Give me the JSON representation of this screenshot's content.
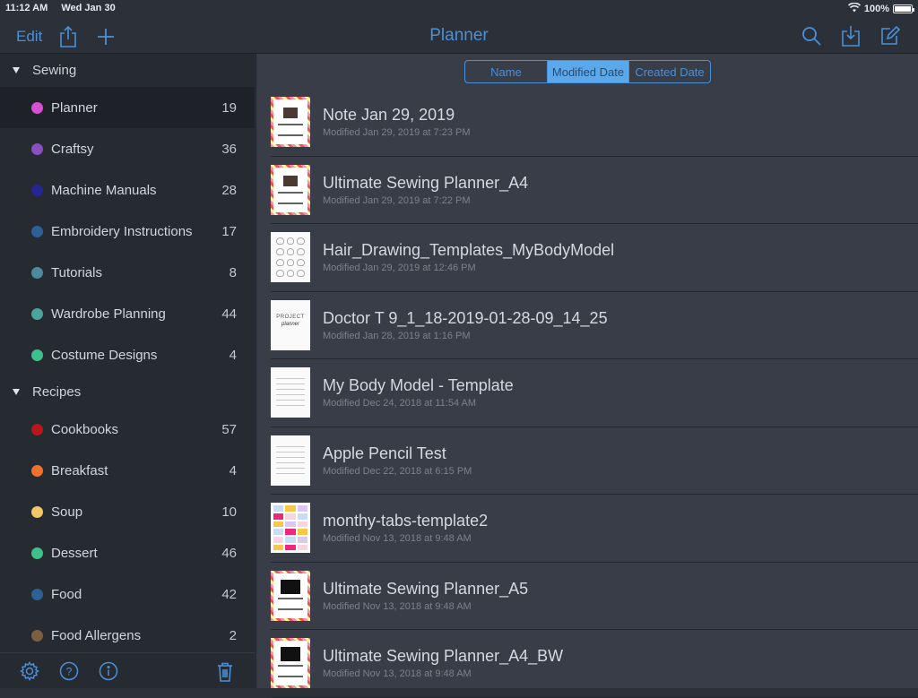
{
  "status_bar": {
    "time": "11:12 AM",
    "date": "Wed Jan 30",
    "battery": "100%",
    "battery_level": 1.0
  },
  "nav": {
    "edit_label": "Edit",
    "title": "Planner",
    "left_icons": [
      "share-icon",
      "plus-icon"
    ],
    "right_icons": [
      "search-icon",
      "import-icon",
      "compose-icon"
    ]
  },
  "colors": {
    "accent": "#4a90d9",
    "segment_active": "#5aa9ec",
    "sidebar_bg": "#262a31",
    "main_bg": "#383d47"
  },
  "sidebar": {
    "groups": [
      {
        "label": "Sewing",
        "items": [
          {
            "label": "Planner",
            "count": "19",
            "color": "#d94fd1",
            "selected": true
          },
          {
            "label": "Craftsy",
            "count": "36",
            "color": "#8a4fc1"
          },
          {
            "label": "Machine Manuals",
            "count": "28",
            "color": "#25259a"
          },
          {
            "label": "Embroidery Instructions",
            "count": "17",
            "color": "#2d6196"
          },
          {
            "label": "Tutorials",
            "count": "8",
            "color": "#4d8a9e"
          },
          {
            "label": "Wardrobe Planning",
            "count": "44",
            "color": "#4ba59a"
          },
          {
            "label": "Costume Designs",
            "count": "4",
            "color": "#3ec08a"
          }
        ]
      },
      {
        "label": "Recipes",
        "items": [
          {
            "label": "Cookbooks",
            "count": "57",
            "color": "#b8171b"
          },
          {
            "label": "Breakfast",
            "count": "4",
            "color": "#f0722a"
          },
          {
            "label": "Soup",
            "count": "10",
            "color": "#f2c766"
          },
          {
            "label": "Dessert",
            "count": "46",
            "color": "#3ec08a"
          },
          {
            "label": "Food",
            "count": "42",
            "color": "#2d6196"
          },
          {
            "label": "Food Allergens",
            "count": "2",
            "color": "#7a6040"
          }
        ]
      }
    ],
    "footer_icons": [
      "gear-icon",
      "help-icon",
      "info-icon",
      "trash-icon"
    ]
  },
  "sort": {
    "options": [
      "Name",
      "Modified Date",
      "Created Date"
    ],
    "selected": "Modified Date"
  },
  "documents": [
    {
      "name": "Note Jan 29, 2019",
      "meta": "Modified Jan 29, 2019 at 7:23 PM",
      "thumb": "sewing"
    },
    {
      "name": "Ultimate Sewing Planner_A4",
      "meta": "Modified Jan 29, 2019 at 7:22 PM",
      "thumb": "sewing"
    },
    {
      "name": "Hair_Drawing_Templates_MyBodyModel",
      "meta": "Modified Jan 29, 2019 at 12:46 PM",
      "thumb": "hair"
    },
    {
      "name": "Doctor T 9_1_18-2019-01-28-09_14_25",
      "meta": "Modified Jan 28, 2019 at 1:16 PM",
      "thumb": "project",
      "thumb_text": [
        "PROJECT",
        "planner"
      ]
    },
    {
      "name": "My Body Model - Template",
      "meta": "Modified Dec 24, 2018 at 11:54 AM",
      "thumb": "lines"
    },
    {
      "name": "Apple Pencil Test",
      "meta": "Modified Dec 22, 2018 at 6:15 PM",
      "thumb": "lines"
    },
    {
      "name": "monthy-tabs-template2",
      "meta": "Modified Nov 13, 2018 at 9:48 AM",
      "thumb": "grid"
    },
    {
      "name": "Ultimate Sewing Planner_A5",
      "meta": "Modified Nov 13, 2018 at 9:48 AM",
      "thumb": "sewing-dark"
    },
    {
      "name": "Ultimate Sewing Planner_A4_BW",
      "meta": "Modified Nov 13, 2018 at 9:48 AM",
      "thumb": "sewing-dark"
    }
  ]
}
